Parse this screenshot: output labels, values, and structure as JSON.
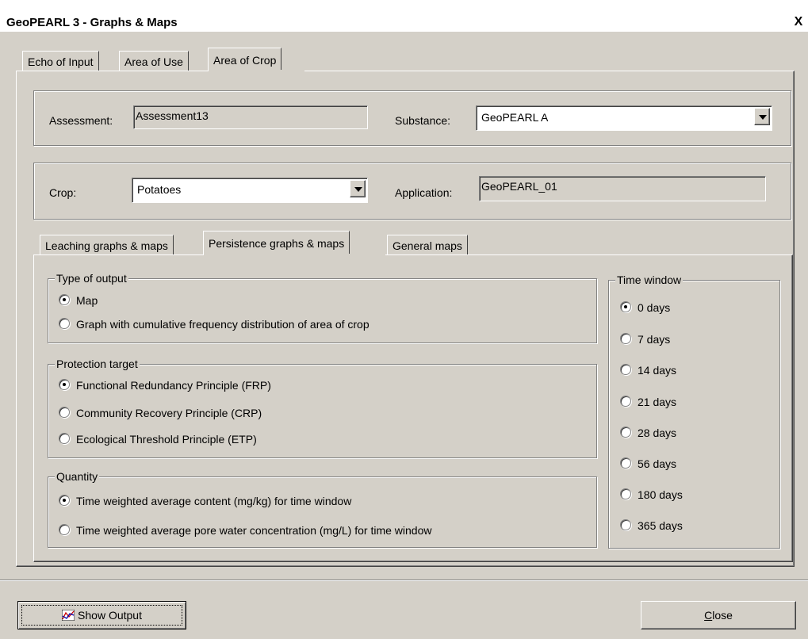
{
  "window": {
    "title": "GeoPEARL 3 - Graphs & Maps",
    "close_glyph": "X"
  },
  "top_tabs": [
    {
      "label": "Echo of Input",
      "active": false
    },
    {
      "label": "Area of Use",
      "active": false
    },
    {
      "label": "Area of Crop",
      "active": true
    }
  ],
  "assessment": {
    "label": "Assessment:",
    "value": "Assessment13"
  },
  "substance": {
    "label": "Substance:",
    "value": "GeoPEARL A"
  },
  "crop": {
    "label": "Crop:",
    "value": "Potatoes"
  },
  "application": {
    "label": "Application:",
    "value": "GeoPEARL_01"
  },
  "sub_tabs": [
    {
      "label": "Leaching graphs & maps",
      "active": false
    },
    {
      "label": "Persistence graphs & maps",
      "active": true
    },
    {
      "label": "General maps",
      "active": false
    }
  ],
  "type_of_output": {
    "legend": "Type of output",
    "options": [
      {
        "label": "Map",
        "selected": true
      },
      {
        "label": "Graph with cumulative frequency distribution of area of crop",
        "selected": false
      }
    ]
  },
  "protection_target": {
    "legend": "Protection target",
    "options": [
      {
        "label": "Functional Redundancy Principle (FRP)",
        "selected": true
      },
      {
        "label": "Community Recovery Principle (CRP)",
        "selected": false
      },
      {
        "label": "Ecological Threshold Principle (ETP)",
        "selected": false
      }
    ]
  },
  "quantity": {
    "legend": "Quantity",
    "options": [
      {
        "label": "Time weighted average content (mg/kg) for time window",
        "selected": true
      },
      {
        "label": "Time weighted average pore water concentration (mg/L) for time window",
        "selected": false
      }
    ]
  },
  "time_window": {
    "legend": "Time window",
    "options": [
      {
        "label": "0 days",
        "selected": true
      },
      {
        "label": "7 days",
        "selected": false
      },
      {
        "label": "14 days",
        "selected": false
      },
      {
        "label": "21 days",
        "selected": false
      },
      {
        "label": "28 days",
        "selected": false
      },
      {
        "label": "56 days",
        "selected": false
      },
      {
        "label": "180 days",
        "selected": false
      },
      {
        "label": "365 days",
        "selected": false
      }
    ]
  },
  "buttons": {
    "show_output": "Show Output",
    "show_output_icon": "chart-icon",
    "close_underlined": "C",
    "close_rest": "lose"
  },
  "colors": {
    "face": "#d4d0c8",
    "title_bg": "#ffffff"
  }
}
